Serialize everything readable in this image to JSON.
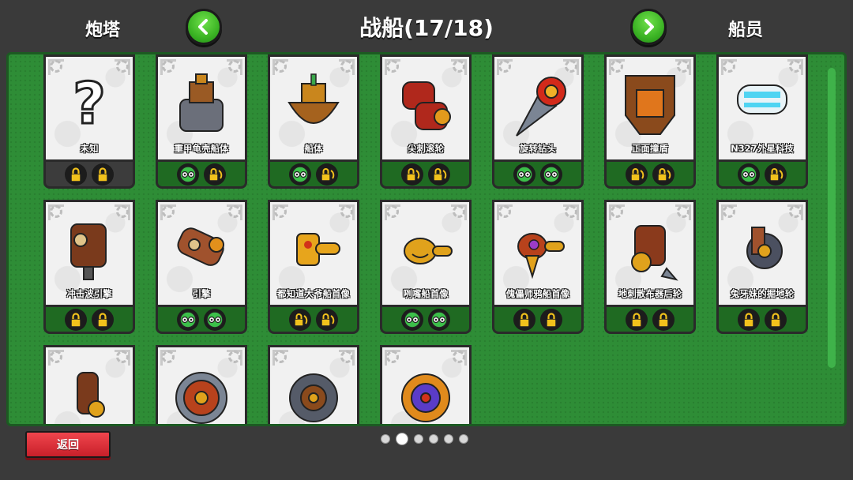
{
  "header": {
    "left_tab": "炮塔",
    "title": "战船(17/18)",
    "right_tab": "船员"
  },
  "cards": [
    {
      "name": "未知",
      "icon": "question-mark-icon",
      "foot": "gray",
      "slots": [
        "lock-icon",
        "lock-icon"
      ]
    },
    {
      "name": "重甲龟壳船体",
      "icon": "armored-hull-icon",
      "foot": "green",
      "slots": [
        "goggles-icon",
        "lock-refresh-icon"
      ]
    },
    {
      "name": "船体",
      "icon": "hull-icon",
      "foot": "green",
      "slots": [
        "goggles-icon",
        "lock-refresh-icon"
      ]
    },
    {
      "name": "尖刺滚轮",
      "icon": "spiked-roller-icon",
      "foot": "green",
      "slots": [
        "lock-refresh-icon",
        "lock-refresh-icon"
      ]
    },
    {
      "name": "旋转钻头",
      "icon": "drill-icon",
      "foot": "green",
      "slots": [
        "goggles-icon",
        "goggles-icon"
      ]
    },
    {
      "name": "正面撞盾",
      "icon": "ram-shield-icon",
      "foot": "green",
      "slots": [
        "lock-refresh-icon",
        "lock-refresh-icon"
      ]
    },
    {
      "name": "N327外星科技",
      "icon": "alien-tech-icon",
      "foot": "green",
      "slots": [
        "goggles-icon",
        "lock-refresh-icon"
      ]
    },
    {
      "name": "冲击波引擎",
      "icon": "shockwave-engine-icon",
      "foot": "green",
      "slots": [
        "lock-icon",
        "lock-icon"
      ]
    },
    {
      "name": "引擎",
      "icon": "engine-icon",
      "foot": "green",
      "slots": [
        "goggles-icon",
        "goggles-icon"
      ]
    },
    {
      "name": "都知道大爷船首像",
      "icon": "golden-figurehead-icon",
      "foot": "green",
      "slots": [
        "lock-refresh-icon",
        "lock-refresh-icon"
      ]
    },
    {
      "name": "咧嘴船首像",
      "icon": "grin-figurehead-icon",
      "foot": "green",
      "slots": [
        "goggles-icon",
        "goggles-icon"
      ]
    },
    {
      "name": "傀儡师鸦船首像",
      "icon": "crow-figurehead-icon",
      "foot": "green",
      "slots": [
        "lock-icon",
        "lock-icon"
      ]
    },
    {
      "name": "地刺散布器后轮",
      "icon": "caltrop-wheel-icon",
      "foot": "green",
      "slots": [
        "lock-icon",
        "lock-icon"
      ]
    },
    {
      "name": "兔牙妹的掘地轮",
      "icon": "digging-wheel-icon",
      "foot": "green",
      "slots": [
        "lock-icon",
        "lock-icon"
      ]
    },
    {
      "name": "",
      "icon": "claw-wheel-icon",
      "foot": "none",
      "slots": []
    },
    {
      "name": "",
      "icon": "saw-wheel-icon",
      "foot": "none",
      "slots": []
    },
    {
      "name": "",
      "icon": "gear-wheel-icon",
      "foot": "none",
      "slots": []
    },
    {
      "name": "",
      "icon": "blade-wheel-icon",
      "foot": "none",
      "slots": []
    }
  ],
  "pagination": {
    "total": 6,
    "active": 1
  },
  "back_button": {
    "label": "返回"
  },
  "colors": {
    "panel": "#2e8d36",
    "foot": "#1f6a22",
    "back": "#e0343d",
    "nav": "#3bb324"
  }
}
